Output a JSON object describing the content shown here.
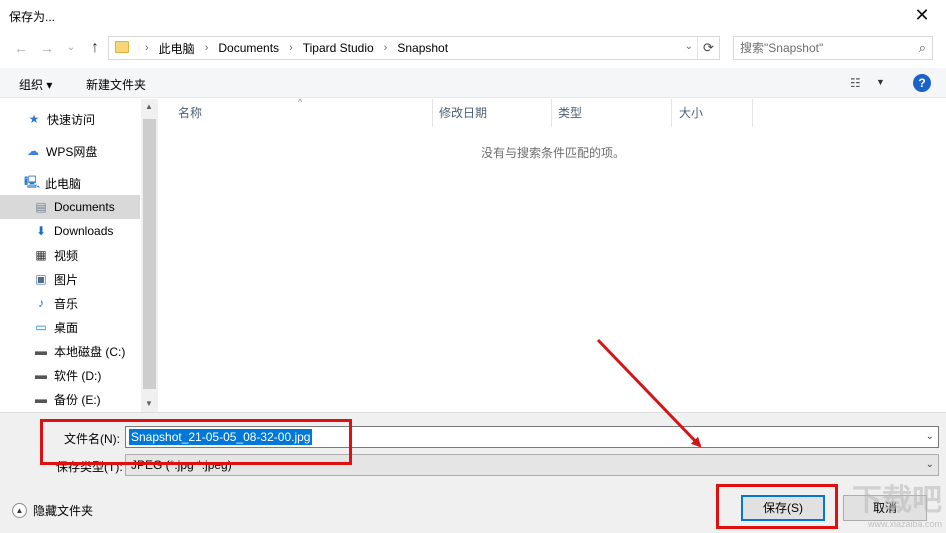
{
  "window": {
    "title": "保存为..."
  },
  "nav": {
    "back": "←",
    "forward": "→",
    "recent": "⌄",
    "up": "↑"
  },
  "breadcrumb": [
    "此电脑",
    "Documents",
    "Tipard Studio",
    "Snapshot"
  ],
  "search": {
    "placeholder": "搜索\"Snapshot\""
  },
  "toolbar": {
    "organize": "组织 ▾",
    "new_folder": "新建文件夹"
  },
  "sidebar": {
    "items": [
      {
        "label": "快速访问",
        "icon": "quick-access-icon"
      },
      {
        "label": "WPS网盘",
        "icon": "cloud-icon"
      },
      {
        "label": "此电脑",
        "icon": "computer-icon"
      },
      {
        "label": "Documents",
        "icon": "document-icon",
        "selected": true
      },
      {
        "label": "Downloads",
        "icon": "download-icon"
      },
      {
        "label": "视频",
        "icon": "video-icon"
      },
      {
        "label": "图片",
        "icon": "picture-icon"
      },
      {
        "label": "音乐",
        "icon": "music-icon"
      },
      {
        "label": "桌面",
        "icon": "desktop-icon"
      },
      {
        "label": "本地磁盘 (C:)",
        "icon": "drive-icon"
      },
      {
        "label": "软件 (D:)",
        "icon": "drive-icon"
      },
      {
        "label": "备份 (E:)",
        "icon": "drive-icon"
      }
    ]
  },
  "columns": [
    "名称",
    "修改日期",
    "类型",
    "大小"
  ],
  "empty_message": "没有与搜索条件匹配的项。",
  "filename": {
    "label": "文件名(N):",
    "value": "Snapshot_21-05-05_08-32-00.jpg"
  },
  "filetype": {
    "label": "保存类型(T):",
    "value": "JPEG (*.jpg *.jpeg)"
  },
  "hide_folders": "隐藏文件夹",
  "buttons": {
    "save": "保存(S)",
    "cancel": "取消"
  },
  "watermark": {
    "main": "下载吧",
    "url": "www.xiazaiba.com"
  },
  "colors": {
    "accent": "#0078d7",
    "annotation": "#e01010",
    "help": "#1a64c8"
  }
}
